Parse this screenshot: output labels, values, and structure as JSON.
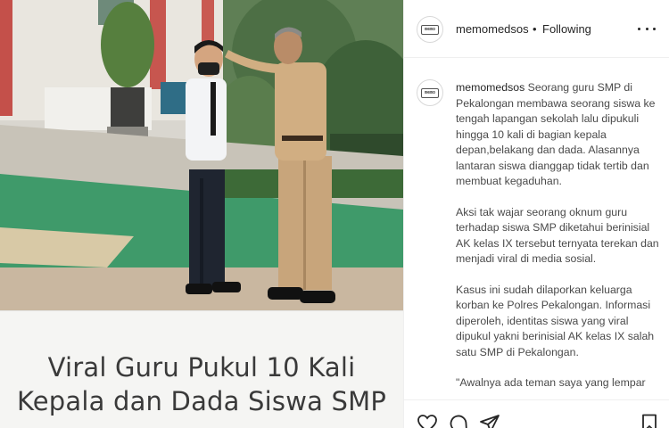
{
  "post": {
    "headline_lines": [
      "Viral Guru Pukul 10 Kali",
      "Kepala dan Dada Siswa SMP"
    ]
  },
  "header": {
    "username": "memomedsos",
    "separator": "•",
    "follow_status": "Following",
    "avatar_logo": "memo",
    "more_icon": "more-horizontal-icon"
  },
  "caption": {
    "username": "memomedsos",
    "paragraph_1": "Seorang guru SMP di Pekalongan membawa seorang siswa ke tengah lapangan sekolah lalu dipukuli hingga 10 kali di bagian kepala depan,belakang dan dada. Alasannya lantaran siswa dianggap tidak tertib dan membuat kegaduhan.",
    "paragraph_2": "Aksi tak wajar seorang oknum guru terhadap siswa SMP diketahui berinisial AK kelas IX tersebut ternyata terekan dan menjadi viral di media sosial.",
    "paragraph_3": "Kasus ini sudah dilaporkan keluarga korban ke Polres Pekalongan. Informasi diperoleh, identitas siswa yang viral dipukul yakni berinisial AK kelas IX salah satu SMP di Pekalongan.",
    "paragraph_4": "\"Awalnya ada teman saya yang lempar"
  },
  "actions": {
    "like_icon": "heart-icon",
    "comment_icon": "comment-icon",
    "share_icon": "paper-plane-icon",
    "save_icon": "bookmark-icon"
  },
  "colors": {
    "text": "#262626",
    "muted": "#4a4a4a",
    "divider": "#efefef",
    "field_green": "#3f9a6a"
  }
}
